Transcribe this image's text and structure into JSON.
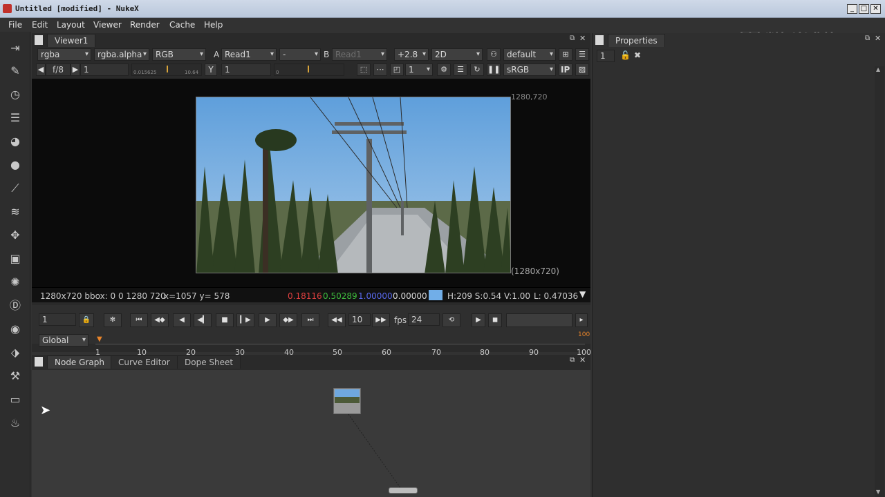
{
  "window": {
    "title": "Untitled [modified] - NukeX",
    "watermark": "中新金桥"
  },
  "menu": [
    "File",
    "Edit",
    "Layout",
    "Viewer",
    "Render",
    "Cache",
    "Help"
  ],
  "viewer": {
    "tab_label": "Viewer1",
    "row1": {
      "channels": "rgba",
      "alpha_channel": "rgba.alpha",
      "display_channels": "RGB",
      "a_label": "A",
      "a_input": "Read1",
      "operation": "-",
      "b_label": "B",
      "b_input": "Read1",
      "gain": "+2.8",
      "view_mode": "2D",
      "lut": "default"
    },
    "row2": {
      "fstop": "f/8",
      "gain_value": "1",
      "gain_slider_min": "0.015625",
      "gain_slider_max": "10.64",
      "y_label": "Y",
      "gamma_value": "1",
      "gamma_slider_min": "0",
      "proxy_value": "1",
      "colorspace": "sRGB",
      "ip_label": "IP"
    },
    "format_label_top": "1280,720",
    "format_label_bottom": "(1280x720)",
    "info": {
      "bbox": "1280x720 bbox: 0 0 1280 720",
      "coords": "x=1057 y= 578",
      "r": "0.18116",
      "g": "0.50289",
      "b": "1.00000",
      "a": "0.00000",
      "swatch_color": "#71aee8",
      "hsv": "H:209 S:0.54 V:1.00",
      "lum": "L: 0.47036"
    },
    "colors": {
      "r": "#e04040",
      "g": "#3fbf3f",
      "b": "#4f5fe8"
    }
  },
  "transport": {
    "frame": "1",
    "increment": "10",
    "fps_label": "fps",
    "fps_value": "24",
    "range_mode": "Global",
    "end_frame_marker": "100",
    "ticks": [
      "1",
      "10",
      "20",
      "30",
      "40",
      "50",
      "60",
      "70",
      "80",
      "90",
      "100"
    ]
  },
  "nodegraph": {
    "tabs": [
      "Node Graph",
      "Curve Editor",
      "Dope Sheet"
    ]
  },
  "properties": {
    "tab_label": "Properties",
    "max_panels": "1"
  }
}
